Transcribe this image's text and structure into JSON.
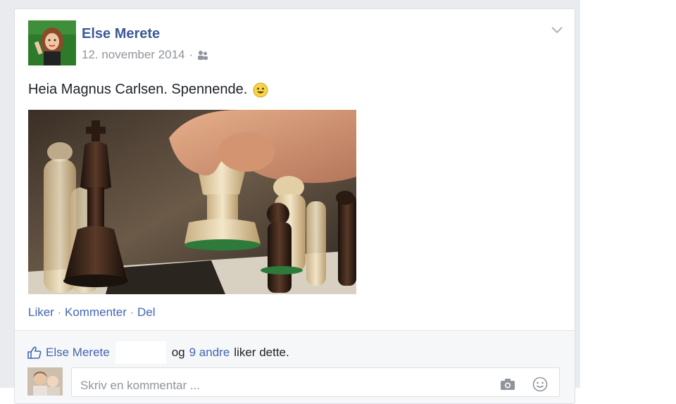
{
  "post": {
    "author": "Else Merete",
    "date": "12. november 2014",
    "audience_icon": "friends-icon",
    "text": "Heia Magnus Carlsen. Spennende.",
    "text_emoji": "smiley-emoji-icon",
    "photo_subject": "chess-pieces-photo"
  },
  "actions": {
    "like": "Liker",
    "separator": "·",
    "comment": "Kommenter",
    "share": "Del"
  },
  "likes": {
    "first_name": "Else Merete",
    "conjunction": "og",
    "others": "9 andre",
    "suffix": "liker dette."
  },
  "comment": {
    "placeholder": "Skriv en kommentar ..."
  },
  "colors": {
    "link": "#4267b2",
    "author": "#3b5998",
    "feed_bg": "#e9ebee"
  }
}
